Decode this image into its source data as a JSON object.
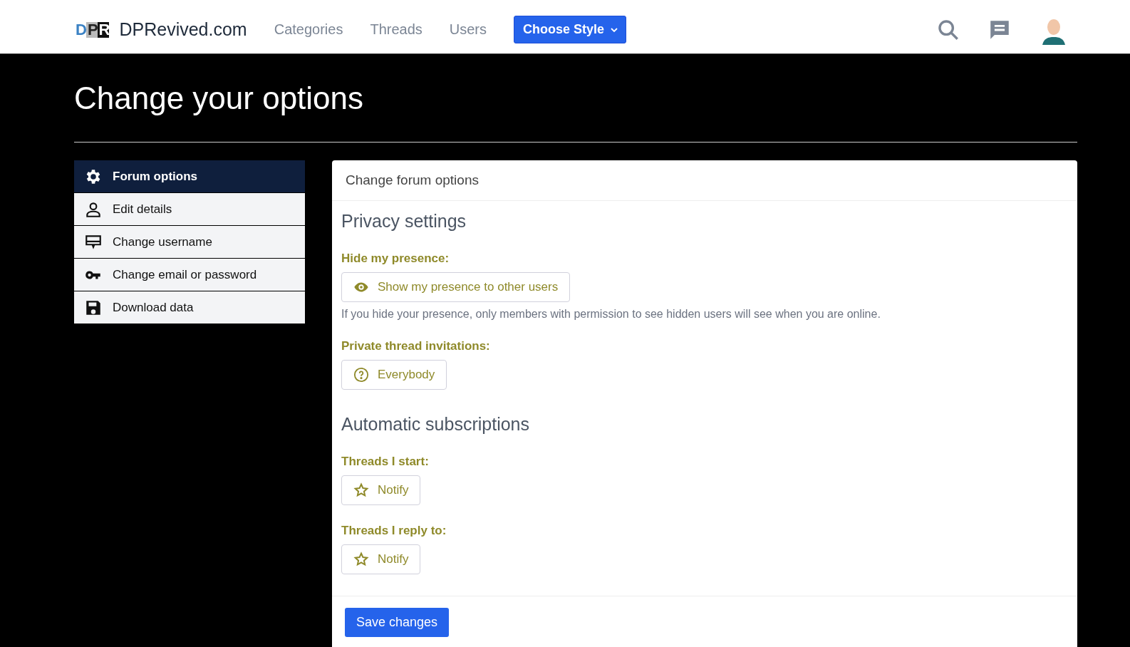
{
  "header": {
    "logo": "DPR",
    "site_name": "DPRevived.com",
    "nav": [
      {
        "label": "Categories"
      },
      {
        "label": "Threads"
      },
      {
        "label": "Users"
      }
    ],
    "style_button": "Choose Style"
  },
  "page_title": "Change your options",
  "sidebar": {
    "items": [
      {
        "label": "Forum options",
        "selected": true
      },
      {
        "label": "Edit details",
        "selected": false
      },
      {
        "label": "Change username",
        "selected": false
      },
      {
        "label": "Change email or password",
        "selected": false
      },
      {
        "label": "Download data",
        "selected": false
      }
    ]
  },
  "panel": {
    "title": "Change forum options",
    "sections": [
      {
        "heading": "Privacy settings",
        "fields": [
          {
            "label": "Hide my presence:",
            "button": "Show my presence to other users",
            "kind": "visibility",
            "help": "If you hide your presence, only members with permission to see hidden users will see when you are online."
          },
          {
            "label": "Private thread invitations:",
            "button": "Everybody",
            "kind": "choice"
          }
        ]
      },
      {
        "heading": "Automatic subscriptions",
        "fields": [
          {
            "label": "Threads I start:",
            "button": "Notify",
            "kind": "subscription"
          },
          {
            "label": "Threads I reply to:",
            "button": "Notify",
            "kind": "subscription"
          }
        ]
      }
    ],
    "save_button": "Save changes"
  }
}
